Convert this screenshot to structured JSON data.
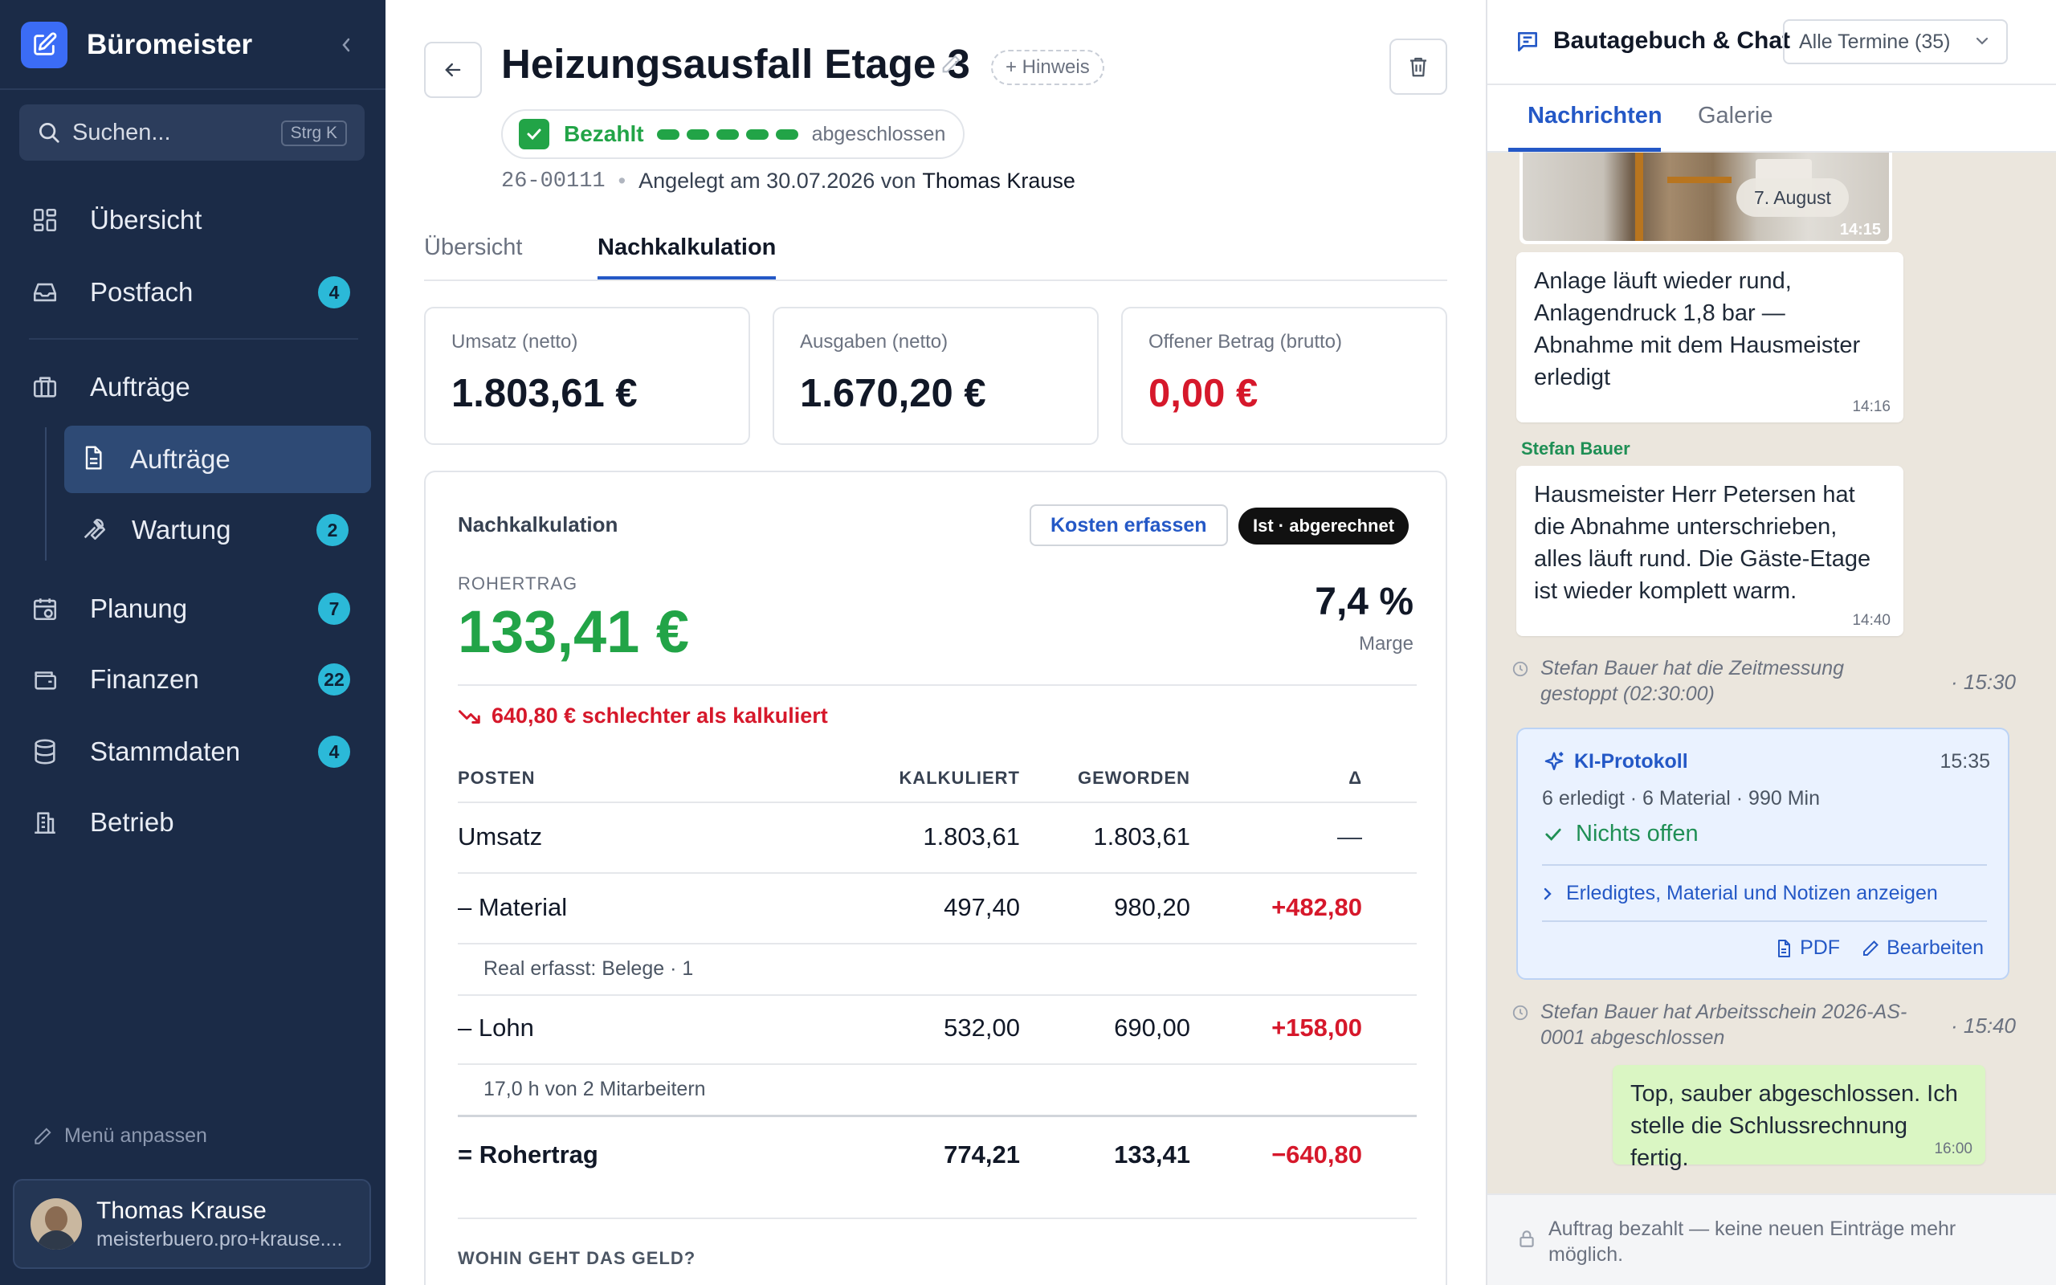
{
  "app": {
    "name": "Büromeister"
  },
  "search": {
    "placeholder": "Suchen...",
    "shortcut": "Strg K"
  },
  "sidebar": {
    "items": [
      {
        "label": "Übersicht",
        "icon": "dashboard-icon"
      },
      {
        "label": "Postfach",
        "icon": "inbox-icon",
        "badge": "4"
      },
      {
        "label": "Aufträge",
        "icon": "briefcase-icon"
      },
      {
        "label": "Aufträge",
        "icon": "document-icon",
        "active": true
      },
      {
        "label": "Wartung",
        "icon": "wrench-icon",
        "badge": "2"
      },
      {
        "label": "Planung",
        "icon": "calendar-clock-icon",
        "badge": "7"
      },
      {
        "label": "Finanzen",
        "icon": "wallet-icon",
        "badge": "22"
      },
      {
        "label": "Stammdaten",
        "icon": "database-icon",
        "badge": "4"
      },
      {
        "label": "Betrieb",
        "icon": "building-icon"
      }
    ],
    "menu_edit": "Menü anpassen",
    "user": {
      "name": "Thomas Krause",
      "email": "meisterbuero.pro+krause...."
    }
  },
  "order": {
    "title": "Heizungsausfall Etage 3",
    "hint_button": "+ Hinweis",
    "status": "Bezahlt",
    "status_end": "abgeschlossen",
    "number": "26-00111",
    "created": "Angelegt am 30.07.2026 von",
    "created_by": "Thomas Krause"
  },
  "tabs": [
    "Übersicht",
    "Nachkalkulation"
  ],
  "kpis": [
    {
      "label": "Umsatz (netto)",
      "value": "1.803,61 €"
    },
    {
      "label": "Ausgaben (netto)",
      "value": "1.670,20 €"
    },
    {
      "label": "Offener Betrag (brutto)",
      "value": "0,00 €",
      "color": "#d6182b"
    }
  ],
  "calc": {
    "title": "Nachkalkulation",
    "btn_costs": "Kosten erfassen",
    "btn_state": "Ist · abgerechnet",
    "rohertrag_label": "ROHERTRAG",
    "rohertrag_value": "133,41 €",
    "marge_value": "7,4 %",
    "marge_label": "Marge",
    "worse_text": "640,80 € schlechter als kalkuliert",
    "headers": [
      "POSTEN",
      "KALKULIERT",
      "GEWORDEN",
      "Δ"
    ],
    "rows": [
      {
        "posten": "Umsatz",
        "kalk": "1.803,61",
        "geworden": "1.803,61",
        "delta": "—"
      },
      {
        "posten": "– Material",
        "kalk": "497,40",
        "geworden": "980,20",
        "delta": "+482,80",
        "note": "Real erfasst: Belege · 1"
      },
      {
        "posten": "– Lohn",
        "kalk": "532,00",
        "geworden": "690,00",
        "delta": "+158,00",
        "note": "17,0 h von 2 Mitarbeitern"
      },
      {
        "posten": "= Rohertrag",
        "kalk": "774,21",
        "geworden": "133,41",
        "delta": "−640,80"
      }
    ],
    "section_next": "WOHIN GEHT DAS GELD?"
  },
  "chat": {
    "title": "Bautagebuch & Chat",
    "filter": "Alle Termine (35)",
    "tabs": [
      "Nachrichten",
      "Galerie"
    ],
    "photo": {
      "date": "7. August",
      "time": "14:15"
    },
    "msg1": {
      "text": "Anlage läuft wieder rund, Anlagendruck 1,8 bar — Abnahme mit dem Hausmeister erledigt",
      "time": "14:16"
    },
    "sender2": "Stefan Bauer",
    "msg2": {
      "text": "Hausmeister Herr Petersen hat die Abnahme unterschrieben, alles läuft rund. Die Gäste-Etage ist wieder komplett warm.",
      "time": "14:40"
    },
    "sys1": {
      "text": "Stefan Bauer hat die Zeitmessung gestoppt (02:30:00)",
      "time": "· 15:30"
    },
    "ki": {
      "title": "KI-Protokoll",
      "time": "15:35",
      "meta": "6 erledigt · 6 Material · 990 Min",
      "ok": "Nichts offen",
      "more": "Erledigtes, Material und Notizen anzeigen",
      "pdf": "PDF",
      "edit": "Bearbeiten"
    },
    "sys2": {
      "text": "Stefan Bauer hat Arbeitsschein 2026-AS-0001 abgeschlossen",
      "time": "· 15:40"
    },
    "msg3": {
      "text": "Top, sauber abgeschlossen. Ich stelle die Schlussrechnung fertig.",
      "time": "16:00"
    },
    "locked": "Auftrag bezahlt — keine neuen Einträge mehr möglich."
  }
}
